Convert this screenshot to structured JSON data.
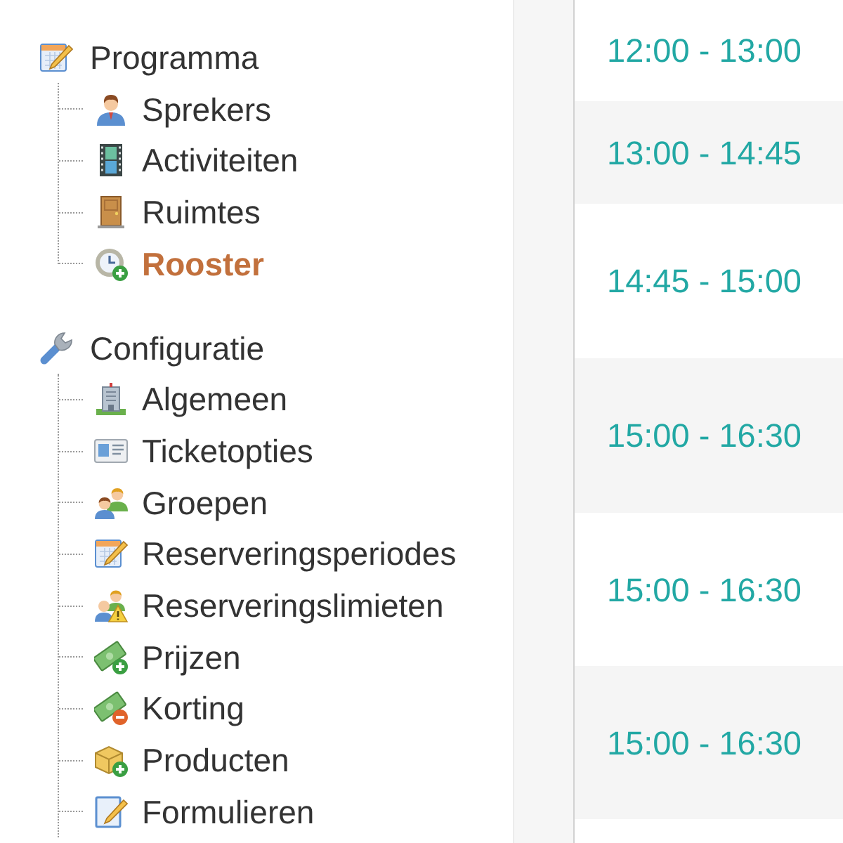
{
  "sidebar": {
    "groups": [
      {
        "label": "Programma",
        "selected": false,
        "children": [
          {
            "label": "Sprekers",
            "selected": false
          },
          {
            "label": "Activiteiten",
            "selected": false
          },
          {
            "label": "Ruimtes",
            "selected": false
          },
          {
            "label": "Rooster",
            "selected": true
          }
        ]
      },
      {
        "label": "Configuratie",
        "selected": false,
        "children": [
          {
            "label": "Algemeen",
            "selected": false
          },
          {
            "label": "Ticketopties",
            "selected": false
          },
          {
            "label": "Groepen",
            "selected": false
          },
          {
            "label": "Reserveringsperiodes",
            "selected": false
          },
          {
            "label": "Reserveringslimieten",
            "selected": false
          },
          {
            "label": "Prijzen",
            "selected": false
          },
          {
            "label": "Korting",
            "selected": false
          },
          {
            "label": "Producten",
            "selected": false
          },
          {
            "label": "Formulieren",
            "selected": false
          }
        ]
      }
    ]
  },
  "schedule": {
    "rows": [
      {
        "time": "12:00 - 13:00"
      },
      {
        "time": "13:00 - 14:45"
      },
      {
        "time": "14:45 - 15:00"
      },
      {
        "time": "15:00 - 16:30"
      },
      {
        "time": "15:00 - 16:30"
      },
      {
        "time": "15:00 - 16:30"
      }
    ]
  }
}
